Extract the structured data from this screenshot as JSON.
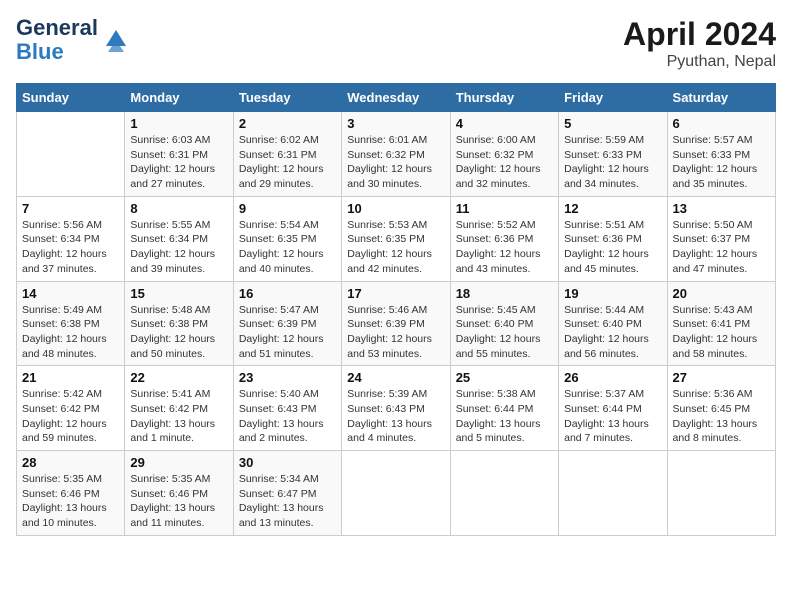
{
  "header": {
    "logo_line1": "General",
    "logo_line2": "Blue",
    "month_year": "April 2024",
    "location": "Pyuthan, Nepal"
  },
  "weekdays": [
    "Sunday",
    "Monday",
    "Tuesday",
    "Wednesday",
    "Thursday",
    "Friday",
    "Saturday"
  ],
  "weeks": [
    [
      {
        "day": "",
        "info": ""
      },
      {
        "day": "1",
        "info": "Sunrise: 6:03 AM\nSunset: 6:31 PM\nDaylight: 12 hours\nand 27 minutes."
      },
      {
        "day": "2",
        "info": "Sunrise: 6:02 AM\nSunset: 6:31 PM\nDaylight: 12 hours\nand 29 minutes."
      },
      {
        "day": "3",
        "info": "Sunrise: 6:01 AM\nSunset: 6:32 PM\nDaylight: 12 hours\nand 30 minutes."
      },
      {
        "day": "4",
        "info": "Sunrise: 6:00 AM\nSunset: 6:32 PM\nDaylight: 12 hours\nand 32 minutes."
      },
      {
        "day": "5",
        "info": "Sunrise: 5:59 AM\nSunset: 6:33 PM\nDaylight: 12 hours\nand 34 minutes."
      },
      {
        "day": "6",
        "info": "Sunrise: 5:57 AM\nSunset: 6:33 PM\nDaylight: 12 hours\nand 35 minutes."
      }
    ],
    [
      {
        "day": "7",
        "info": "Sunrise: 5:56 AM\nSunset: 6:34 PM\nDaylight: 12 hours\nand 37 minutes."
      },
      {
        "day": "8",
        "info": "Sunrise: 5:55 AM\nSunset: 6:34 PM\nDaylight: 12 hours\nand 39 minutes."
      },
      {
        "day": "9",
        "info": "Sunrise: 5:54 AM\nSunset: 6:35 PM\nDaylight: 12 hours\nand 40 minutes."
      },
      {
        "day": "10",
        "info": "Sunrise: 5:53 AM\nSunset: 6:35 PM\nDaylight: 12 hours\nand 42 minutes."
      },
      {
        "day": "11",
        "info": "Sunrise: 5:52 AM\nSunset: 6:36 PM\nDaylight: 12 hours\nand 43 minutes."
      },
      {
        "day": "12",
        "info": "Sunrise: 5:51 AM\nSunset: 6:36 PM\nDaylight: 12 hours\nand 45 minutes."
      },
      {
        "day": "13",
        "info": "Sunrise: 5:50 AM\nSunset: 6:37 PM\nDaylight: 12 hours\nand 47 minutes."
      }
    ],
    [
      {
        "day": "14",
        "info": "Sunrise: 5:49 AM\nSunset: 6:38 PM\nDaylight: 12 hours\nand 48 minutes."
      },
      {
        "day": "15",
        "info": "Sunrise: 5:48 AM\nSunset: 6:38 PM\nDaylight: 12 hours\nand 50 minutes."
      },
      {
        "day": "16",
        "info": "Sunrise: 5:47 AM\nSunset: 6:39 PM\nDaylight: 12 hours\nand 51 minutes."
      },
      {
        "day": "17",
        "info": "Sunrise: 5:46 AM\nSunset: 6:39 PM\nDaylight: 12 hours\nand 53 minutes."
      },
      {
        "day": "18",
        "info": "Sunrise: 5:45 AM\nSunset: 6:40 PM\nDaylight: 12 hours\nand 55 minutes."
      },
      {
        "day": "19",
        "info": "Sunrise: 5:44 AM\nSunset: 6:40 PM\nDaylight: 12 hours\nand 56 minutes."
      },
      {
        "day": "20",
        "info": "Sunrise: 5:43 AM\nSunset: 6:41 PM\nDaylight: 12 hours\nand 58 minutes."
      }
    ],
    [
      {
        "day": "21",
        "info": "Sunrise: 5:42 AM\nSunset: 6:42 PM\nDaylight: 12 hours\nand 59 minutes."
      },
      {
        "day": "22",
        "info": "Sunrise: 5:41 AM\nSunset: 6:42 PM\nDaylight: 13 hours\nand 1 minute."
      },
      {
        "day": "23",
        "info": "Sunrise: 5:40 AM\nSunset: 6:43 PM\nDaylight: 13 hours\nand 2 minutes."
      },
      {
        "day": "24",
        "info": "Sunrise: 5:39 AM\nSunset: 6:43 PM\nDaylight: 13 hours\nand 4 minutes."
      },
      {
        "day": "25",
        "info": "Sunrise: 5:38 AM\nSunset: 6:44 PM\nDaylight: 13 hours\nand 5 minutes."
      },
      {
        "day": "26",
        "info": "Sunrise: 5:37 AM\nSunset: 6:44 PM\nDaylight: 13 hours\nand 7 minutes."
      },
      {
        "day": "27",
        "info": "Sunrise: 5:36 AM\nSunset: 6:45 PM\nDaylight: 13 hours\nand 8 minutes."
      }
    ],
    [
      {
        "day": "28",
        "info": "Sunrise: 5:35 AM\nSunset: 6:46 PM\nDaylight: 13 hours\nand 10 minutes."
      },
      {
        "day": "29",
        "info": "Sunrise: 5:35 AM\nSunset: 6:46 PM\nDaylight: 13 hours\nand 11 minutes."
      },
      {
        "day": "30",
        "info": "Sunrise: 5:34 AM\nSunset: 6:47 PM\nDaylight: 13 hours\nand 13 minutes."
      },
      {
        "day": "",
        "info": ""
      },
      {
        "day": "",
        "info": ""
      },
      {
        "day": "",
        "info": ""
      },
      {
        "day": "",
        "info": ""
      }
    ]
  ]
}
